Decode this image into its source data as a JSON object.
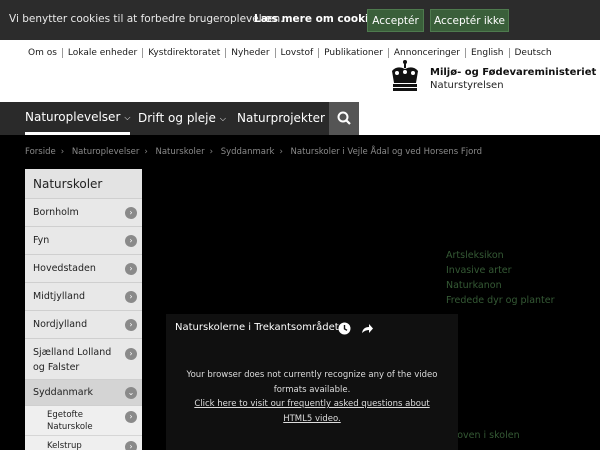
{
  "cookie": {
    "message": "Vi benytter cookies til at forbedre brugeroplevelsen.",
    "more_link": "Læs mere om cookies",
    "accept_label": "Acceptér",
    "deny_label": "Acceptér ikke"
  },
  "topnav": [
    "Om os",
    "Lokale enheder",
    "Kystdirektoratet",
    "Nyheder",
    "Lovstof",
    "Publikationer",
    "Annonceringer",
    "English",
    "Deutsch"
  ],
  "brand": {
    "ministry": "Miljø- og Fødevareministeriet",
    "agency": "Naturstyrelsen"
  },
  "mainnav": {
    "items": [
      "Naturoplevelser",
      "Drift og pleje",
      "Naturprojekter"
    ]
  },
  "breadcrumb": [
    "Forside",
    "Naturoplevelser",
    "Naturskoler",
    "Syddanmark",
    "Naturskoler i Vejle Ådal og ved Horsens Fjord"
  ],
  "sidebar": {
    "title": "Naturskoler",
    "items": [
      "Bornholm",
      "Fyn",
      "Hovedstaden",
      "Midtjylland",
      "Nordjylland",
      "Sjælland Lolland og Falster",
      "Syddanmark"
    ],
    "subitems": [
      "Egetofte Naturskole",
      "Kelstrup"
    ]
  },
  "related_links": [
    "Artsleksikon",
    "Invasive arter",
    "Naturkanon",
    "Fredede dyr og planter"
  ],
  "bottom_link": "Skoven i skolen",
  "video": {
    "title": "Naturskolerne i Trekantsområdet",
    "line1": "Your browser does not currently recognize any of the video",
    "line2": "formats available.",
    "link1": "Click here to visit our frequently asked questions about",
    "link2": "HTML5 video."
  },
  "colors": {
    "cookie_bg": "#2c2c2c",
    "button": "#3a5f3a",
    "nav_bg": "#2a2a2a",
    "link_green": "#355a35"
  }
}
